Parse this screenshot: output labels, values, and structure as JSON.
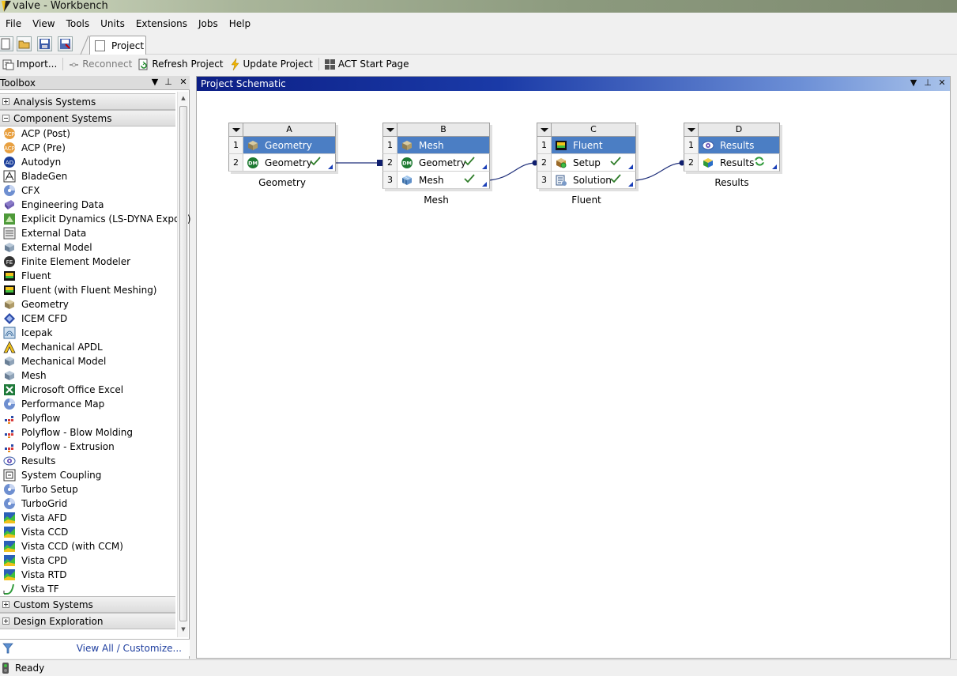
{
  "window": {
    "title": "valve - Workbench"
  },
  "menu": [
    "File",
    "View",
    "Tools",
    "Units",
    "Extensions",
    "Jobs",
    "Help"
  ],
  "tabs": {
    "project": "Project"
  },
  "toolbar2": {
    "import": "Import...",
    "reconnect": "Reconnect",
    "refresh": "Refresh Project",
    "update": "Update Project",
    "act": "ACT Start Page"
  },
  "toolbox": {
    "title": "Toolbox",
    "sections": {
      "analysis": "Analysis Systems",
      "component": "Component Systems",
      "custom": "Custom Systems",
      "design": "Design Exploration"
    },
    "items": [
      {
        "label": "ACP (Post)",
        "icon": "acp-post-icon"
      },
      {
        "label": "ACP (Pre)",
        "icon": "acp-pre-icon"
      },
      {
        "label": "Autodyn",
        "icon": "autodyn-icon"
      },
      {
        "label": "BladeGen",
        "icon": "bladegen-icon"
      },
      {
        "label": "CFX",
        "icon": "cfx-icon"
      },
      {
        "label": "Engineering Data",
        "icon": "engineering-data-icon"
      },
      {
        "label": "Explicit Dynamics (LS-DYNA Export)",
        "icon": "explicit-dynamics-icon"
      },
      {
        "label": "External Data",
        "icon": "external-data-icon"
      },
      {
        "label": "External Model",
        "icon": "external-model-icon"
      },
      {
        "label": "Finite Element Modeler",
        "icon": "fe-modeler-icon"
      },
      {
        "label": "Fluent",
        "icon": "fluent-icon"
      },
      {
        "label": "Fluent (with Fluent Meshing)",
        "icon": "fluent-meshing-icon"
      },
      {
        "label": "Geometry",
        "icon": "geometry-icon"
      },
      {
        "label": "ICEM CFD",
        "icon": "icem-cfd-icon"
      },
      {
        "label": "Icepak",
        "icon": "icepak-icon"
      },
      {
        "label": "Mechanical APDL",
        "icon": "mechanical-apdl-icon"
      },
      {
        "label": "Mechanical Model",
        "icon": "mechanical-model-icon"
      },
      {
        "label": "Mesh",
        "icon": "mesh-icon"
      },
      {
        "label": "Microsoft Office Excel",
        "icon": "excel-icon"
      },
      {
        "label": "Performance Map",
        "icon": "performance-map-icon"
      },
      {
        "label": "Polyflow",
        "icon": "polyflow-icon"
      },
      {
        "label": "Polyflow - Blow Molding",
        "icon": "polyflow-blow-icon"
      },
      {
        "label": "Polyflow - Extrusion",
        "icon": "polyflow-extrusion-icon"
      },
      {
        "label": "Results",
        "icon": "results-icon"
      },
      {
        "label": "System Coupling",
        "icon": "system-coupling-icon"
      },
      {
        "label": "Turbo Setup",
        "icon": "turbo-setup-icon"
      },
      {
        "label": "TurboGrid",
        "icon": "turbogrid-icon"
      },
      {
        "label": "Vista AFD",
        "icon": "vista-afd-icon"
      },
      {
        "label": "Vista CCD",
        "icon": "vista-ccd-icon"
      },
      {
        "label": "Vista CCD (with CCM)",
        "icon": "vista-ccd-ccm-icon"
      },
      {
        "label": "Vista CPD",
        "icon": "vista-cpd-icon"
      },
      {
        "label": "Vista RTD",
        "icon": "vista-rtd-icon"
      },
      {
        "label": "Vista TF",
        "icon": "vista-tf-icon"
      }
    ],
    "view_all": "View All / Customize..."
  },
  "schematic": {
    "title": "Project Schematic",
    "systems": [
      {
        "letter": "A",
        "caption": "Geometry",
        "rows": [
          {
            "num": "1",
            "label": "Geometry",
            "icon": "geometry-cube-icon",
            "state": "header"
          },
          {
            "num": "2",
            "label": "Geometry",
            "icon": "dm-icon",
            "state": "up-to-date"
          }
        ]
      },
      {
        "letter": "B",
        "caption": "Mesh",
        "rows": [
          {
            "num": "1",
            "label": "Mesh",
            "icon": "mesh-cube-icon",
            "state": "header"
          },
          {
            "num": "2",
            "label": "Geometry",
            "icon": "dm-icon",
            "state": "up-to-date"
          },
          {
            "num": "3",
            "label": "Mesh",
            "icon": "mesh-blue-icon",
            "state": "up-to-date"
          }
        ]
      },
      {
        "letter": "C",
        "caption": "Fluent",
        "rows": [
          {
            "num": "1",
            "label": "Fluent",
            "icon": "fluent-icon",
            "state": "header"
          },
          {
            "num": "2",
            "label": "Setup",
            "icon": "setup-icon",
            "state": "up-to-date"
          },
          {
            "num": "3",
            "label": "Solution",
            "icon": "solution-icon",
            "state": "up-to-date"
          }
        ]
      },
      {
        "letter": "D",
        "caption": "Results",
        "rows": [
          {
            "num": "1",
            "label": "Results",
            "icon": "results-eye-icon",
            "state": "header"
          },
          {
            "num": "2",
            "label": "Results",
            "icon": "results-cube-icon",
            "state": "refresh-required"
          }
        ]
      }
    ]
  },
  "status": {
    "text": "Ready"
  },
  "colors": {
    "accent": "#4b7ec4",
    "header": "#0c1f86",
    "link": "#1f3f9f"
  }
}
